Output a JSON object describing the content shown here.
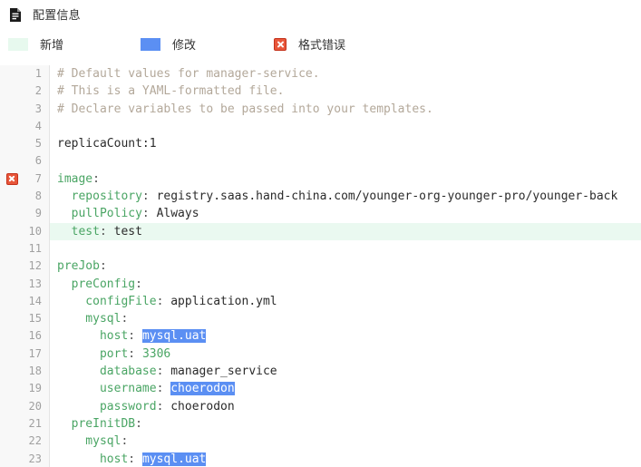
{
  "header": {
    "icon": "file-document-icon",
    "title": "配置信息"
  },
  "legend": {
    "items": [
      {
        "key": "added",
        "icon": "green-swatch",
        "label": "新增",
        "color": "#e7f9ee"
      },
      {
        "key": "changed",
        "icon": "blue-swatch",
        "label": "修改",
        "color": "#5b8ff3"
      },
      {
        "key": "error",
        "icon": "error-x-icon",
        "label": "格式错误",
        "color": "#e8563a"
      }
    ]
  },
  "editor": {
    "language": "yaml",
    "lines": [
      {
        "no": "1",
        "marker": "",
        "state": "normal",
        "tokens": [
          {
            "t": "# Default values for manager-service.",
            "c": "comment"
          }
        ]
      },
      {
        "no": "2",
        "marker": "",
        "state": "normal",
        "tokens": [
          {
            "t": "# This is a YAML-formatted file.",
            "c": "comment"
          }
        ]
      },
      {
        "no": "3",
        "marker": "",
        "state": "normal",
        "tokens": [
          {
            "t": "# Declare variables to be passed into your templates.",
            "c": "comment"
          }
        ]
      },
      {
        "no": "4",
        "marker": "",
        "state": "normal",
        "tokens": []
      },
      {
        "no": "5",
        "marker": "",
        "state": "normal",
        "tokens": [
          {
            "t": "replicaCount:1",
            "c": "plain"
          }
        ]
      },
      {
        "no": "6",
        "marker": "",
        "state": "normal",
        "tokens": []
      },
      {
        "no": "7",
        "marker": "error",
        "state": "normal",
        "tokens": [
          {
            "t": "image",
            "c": "key"
          },
          {
            "t": ":",
            "c": "punct"
          }
        ]
      },
      {
        "no": "8",
        "marker": "",
        "state": "normal",
        "tokens": [
          {
            "t": "  repository",
            "c": "key"
          },
          {
            "t": ": ",
            "c": "punct"
          },
          {
            "t": "registry.saas.hand-china.com/younger-org-younger-pro/younger-back",
            "c": "val"
          }
        ]
      },
      {
        "no": "9",
        "marker": "",
        "state": "normal",
        "tokens": [
          {
            "t": "  pullPolicy",
            "c": "key"
          },
          {
            "t": ": ",
            "c": "punct"
          },
          {
            "t": "Always",
            "c": "val"
          }
        ]
      },
      {
        "no": "10",
        "marker": "",
        "state": "added",
        "tokens": [
          {
            "t": "  test",
            "c": "key"
          },
          {
            "t": ": ",
            "c": "punct"
          },
          {
            "t": "test",
            "c": "val"
          }
        ]
      },
      {
        "no": "11",
        "marker": "",
        "state": "normal",
        "tokens": []
      },
      {
        "no": "12",
        "marker": "",
        "state": "normal",
        "tokens": [
          {
            "t": "preJob",
            "c": "key"
          },
          {
            "t": ":",
            "c": "punct"
          }
        ]
      },
      {
        "no": "13",
        "marker": "",
        "state": "normal",
        "tokens": [
          {
            "t": "  preConfig",
            "c": "key"
          },
          {
            "t": ":",
            "c": "punct"
          }
        ]
      },
      {
        "no": "14",
        "marker": "",
        "state": "normal",
        "tokens": [
          {
            "t": "    configFile",
            "c": "key"
          },
          {
            "t": ": ",
            "c": "punct"
          },
          {
            "t": "application.yml",
            "c": "val"
          }
        ]
      },
      {
        "no": "15",
        "marker": "",
        "state": "normal",
        "tokens": [
          {
            "t": "    mysql",
            "c": "key"
          },
          {
            "t": ":",
            "c": "punct"
          }
        ]
      },
      {
        "no": "16",
        "marker": "",
        "state": "normal",
        "tokens": [
          {
            "t": "      host",
            "c": "key"
          },
          {
            "t": ": ",
            "c": "punct"
          },
          {
            "t": "mysql.uat",
            "c": "sel"
          }
        ]
      },
      {
        "no": "17",
        "marker": "",
        "state": "normal",
        "tokens": [
          {
            "t": "      port",
            "c": "key"
          },
          {
            "t": ": ",
            "c": "punct"
          },
          {
            "t": "3306",
            "c": "num"
          }
        ]
      },
      {
        "no": "18",
        "marker": "",
        "state": "normal",
        "tokens": [
          {
            "t": "      database",
            "c": "key"
          },
          {
            "t": ": ",
            "c": "punct"
          },
          {
            "t": "manager_service",
            "c": "val"
          }
        ]
      },
      {
        "no": "19",
        "marker": "",
        "state": "normal",
        "tokens": [
          {
            "t": "      username",
            "c": "key"
          },
          {
            "t": ": ",
            "c": "punct"
          },
          {
            "t": "choerodon",
            "c": "sel"
          }
        ]
      },
      {
        "no": "20",
        "marker": "",
        "state": "normal",
        "tokens": [
          {
            "t": "      password",
            "c": "key"
          },
          {
            "t": ": ",
            "c": "punct"
          },
          {
            "t": "choerodon",
            "c": "val"
          }
        ]
      },
      {
        "no": "21",
        "marker": "",
        "state": "normal",
        "tokens": [
          {
            "t": "  preInitDB",
            "c": "key"
          },
          {
            "t": ":",
            "c": "punct"
          }
        ]
      },
      {
        "no": "22",
        "marker": "",
        "state": "normal",
        "tokens": [
          {
            "t": "    mysql",
            "c": "key"
          },
          {
            "t": ":",
            "c": "punct"
          }
        ]
      },
      {
        "no": "23",
        "marker": "",
        "state": "normal",
        "tokens": [
          {
            "t": "      host",
            "c": "key"
          },
          {
            "t": ": ",
            "c": "punct"
          },
          {
            "t": "mysql.uat",
            "c": "sel"
          }
        ]
      }
    ]
  }
}
